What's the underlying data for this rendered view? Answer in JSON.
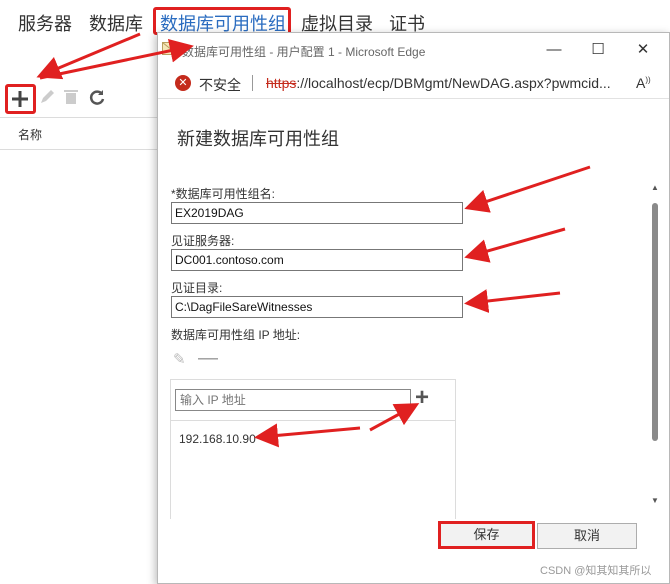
{
  "topnav": {
    "items": [
      "服务器",
      "数据库",
      "数据库可用性组",
      "虚拟目录",
      "证书"
    ]
  },
  "toolbar": {
    "add_icon": "plus-icon",
    "edit_icon": "pencil-icon",
    "delete_icon": "trash-icon",
    "refresh_icon": "refresh-icon"
  },
  "list": {
    "column_header": "名称"
  },
  "popup": {
    "window_title": "数据库可用性组 - 用户配置 1 - Microsoft Edge",
    "insecure_label": "不安全",
    "url_scheme": "https",
    "url_rest": "://localhost/ecp/DBMgmt/NewDAG.aspx?pwmcid...",
    "form_title": "新建数据库可用性组",
    "dag_name_label": "*数据库可用性组名:",
    "dag_name_value": "EX2019DAG",
    "witness_server_label": "见证服务器:",
    "witness_server_value": "DC001.contoso.com",
    "witness_dir_label": "见证目录:",
    "witness_dir_value": "C:\\DagFileSareWitnesses",
    "ip_label": "数据库可用性组 IP 地址:",
    "ip_placeholder": "输入 IP 地址",
    "ip_list": [
      "192.168.10.90"
    ],
    "save_label": "保存",
    "cancel_label": "取消"
  },
  "watermark": "CSDN @知其知其所以",
  "colors": {
    "accent": "#2a6cc0",
    "annotation": "#e02020",
    "insecure": "#c42b1c"
  }
}
